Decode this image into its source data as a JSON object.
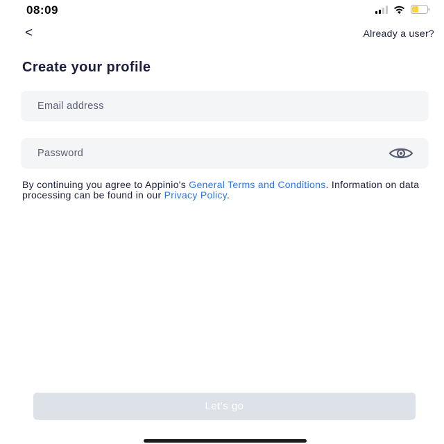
{
  "status_bar": {
    "time": "08:09",
    "icons": [
      "signal-icon",
      "wifi-icon",
      "battery-icon"
    ],
    "battery_color": "#f5d547"
  },
  "nav": {
    "back_icon": "<",
    "already_user_label": "Already a user?"
  },
  "title": "Create your profile",
  "form": {
    "email_placeholder": "Email address",
    "email_value": "",
    "password_placeholder": "Password",
    "password_value": "",
    "password_toggle_icon": "eye-icon"
  },
  "terms": {
    "text_before": "By continuing you agree to Appinio's ",
    "terms_link": "General Terms and Conditions",
    "text_middle": ". Information on data processing can be found in our ",
    "privacy_link": "Privacy Policy",
    "text_after": "."
  },
  "submit": {
    "label": "Let's go",
    "enabled": false
  },
  "colors": {
    "text": "#1b1f3b",
    "link": "#2e76e5",
    "field_bg": "#f4f5f7",
    "button_disabled": "#dde1e8"
  }
}
